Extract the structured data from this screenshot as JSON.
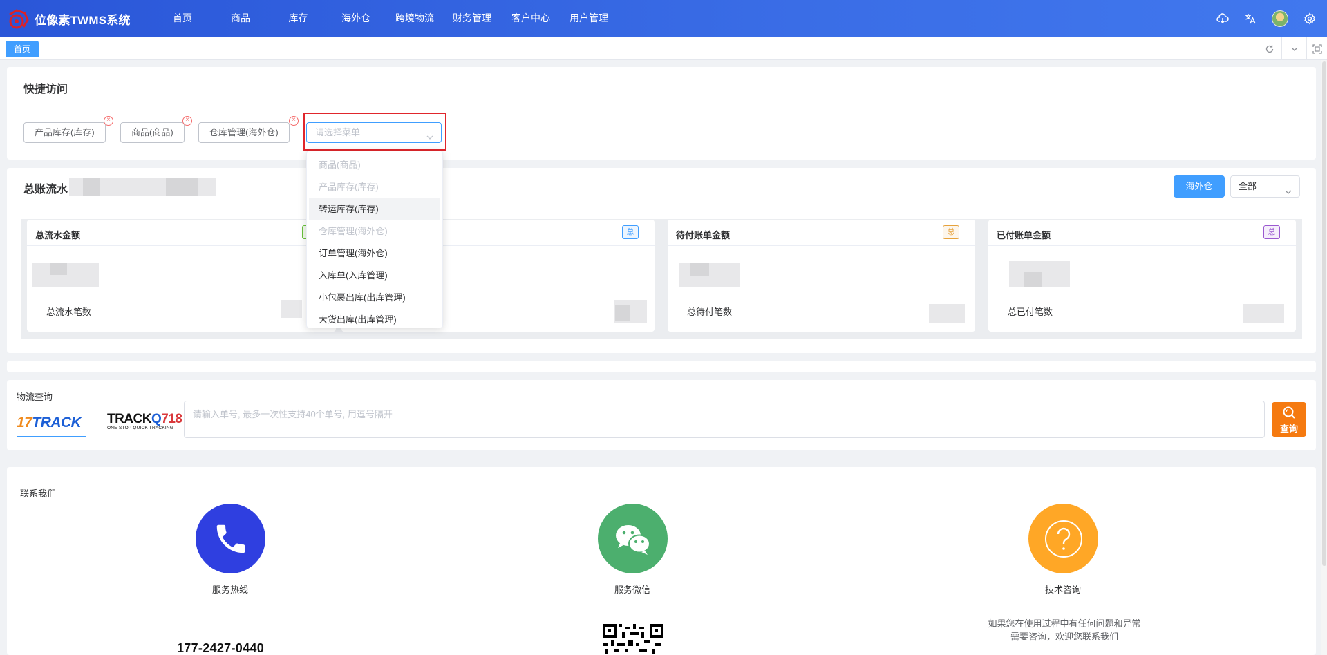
{
  "app": {
    "title": "位像素TWMS系统"
  },
  "nav": [
    "首页",
    "商品",
    "库存",
    "海外仓",
    "跨境物流",
    "财务管理",
    "客户中心",
    "用户管理"
  ],
  "header_icons": [
    "cloud-download-icon",
    "translate-icon",
    "avatar",
    "gear-icon"
  ],
  "tabs": {
    "active": "首页"
  },
  "quick_access": {
    "title": "快捷访问",
    "tags": [
      "产品库存(库存)",
      "商品(商品)",
      "仓库管理(海外仓)"
    ],
    "select_placeholder": "请选择菜单",
    "dropdown": [
      {
        "label": "商品(商品)",
        "disabled": true
      },
      {
        "label": "产品库存(库存)",
        "disabled": true
      },
      {
        "label": "转运库存(库存)",
        "disabled": false,
        "hover": true
      },
      {
        "label": "仓库管理(海外仓)",
        "disabled": true
      },
      {
        "label": "订单管理(海外仓)",
        "disabled": false
      },
      {
        "label": "入库单(入库管理)",
        "disabled": false
      },
      {
        "label": "小包裹出库(出库管理)",
        "disabled": false
      },
      {
        "label": "大货出库(出库管理)",
        "disabled": false
      }
    ]
  },
  "ledger": {
    "title": "总账流水",
    "filter_button": "海外仓",
    "filter_select": "全部",
    "stats": [
      {
        "title": "总流水金额",
        "badge": "",
        "badge_color": "#67c23a",
        "sub": "总流水笔数"
      },
      {
        "title": "",
        "badge": "总",
        "badge_color": "#409eff",
        "sub": ""
      },
      {
        "title": "待付账单金额",
        "badge": "总",
        "badge_color": "#e6a23c",
        "sub": "总待付笔数"
      },
      {
        "title": "已付账单金额",
        "badge": "总",
        "badge_color": "#9b59d0",
        "sub": "总已付笔数"
      }
    ]
  },
  "logistics": {
    "title": "物流查询",
    "provider_1": "17TRACK",
    "provider_2_main": "TRACK718",
    "provider_2_sub": "ONE-STOP QUICK TRACKING",
    "input_placeholder": "请输入单号, 最多一次性支持40个单号, 用逗号隔开",
    "button": "查询"
  },
  "contact": {
    "title": "联系我们",
    "hotline_label": "服务热线",
    "hotline_number": "177-2427-0440",
    "wechat_label": "服务微信",
    "tech_label": "技术咨询",
    "tech_text_1": "如果您在使用过程中有任何问题和异常",
    "tech_text_2": "需要咨询，欢迎您联系我们"
  },
  "colors": {
    "header": "#2f5fe0",
    "primary": "#409eff",
    "phone": "#2f3fe0",
    "wechat": "#4caf6e",
    "tech": "#ffa726",
    "search_btn": "#f57a10"
  }
}
